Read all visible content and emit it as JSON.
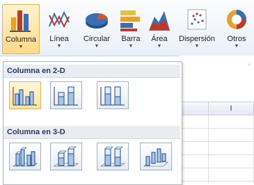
{
  "ribbon": {
    "buttons": [
      {
        "label": "Columna",
        "icon": "column-chart-icon",
        "active": true
      },
      {
        "label": "Línea",
        "icon": "line-chart-icon"
      },
      {
        "label": "Circular",
        "icon": "pie-chart-icon"
      },
      {
        "label": "Barra",
        "icon": "bar-chart-icon"
      },
      {
        "label": "Área",
        "icon": "area-chart-icon"
      },
      {
        "label": "Dispersión",
        "icon": "scatter-chart-icon"
      },
      {
        "label": "Otros",
        "icon": "other-charts-icon"
      }
    ]
  },
  "sheet": {
    "column_header": "I"
  },
  "dropdown": {
    "section_2d": {
      "title": "Columna en 2-D",
      "items": [
        "clustered-column-icon",
        "stacked-column-icon",
        "100-stacked-column-icon"
      ]
    },
    "section_3d": {
      "title": "Columna en 3-D",
      "items": [
        "3d-clustered-column-icon",
        "3d-stacked-column-icon",
        "3d-100-stacked-column-icon",
        "3d-column-icon"
      ]
    }
  },
  "colors": {
    "active_button": "#ffd88a",
    "section_header_bg": "#e9edf2",
    "thumb_border": "#9fb0c4"
  }
}
